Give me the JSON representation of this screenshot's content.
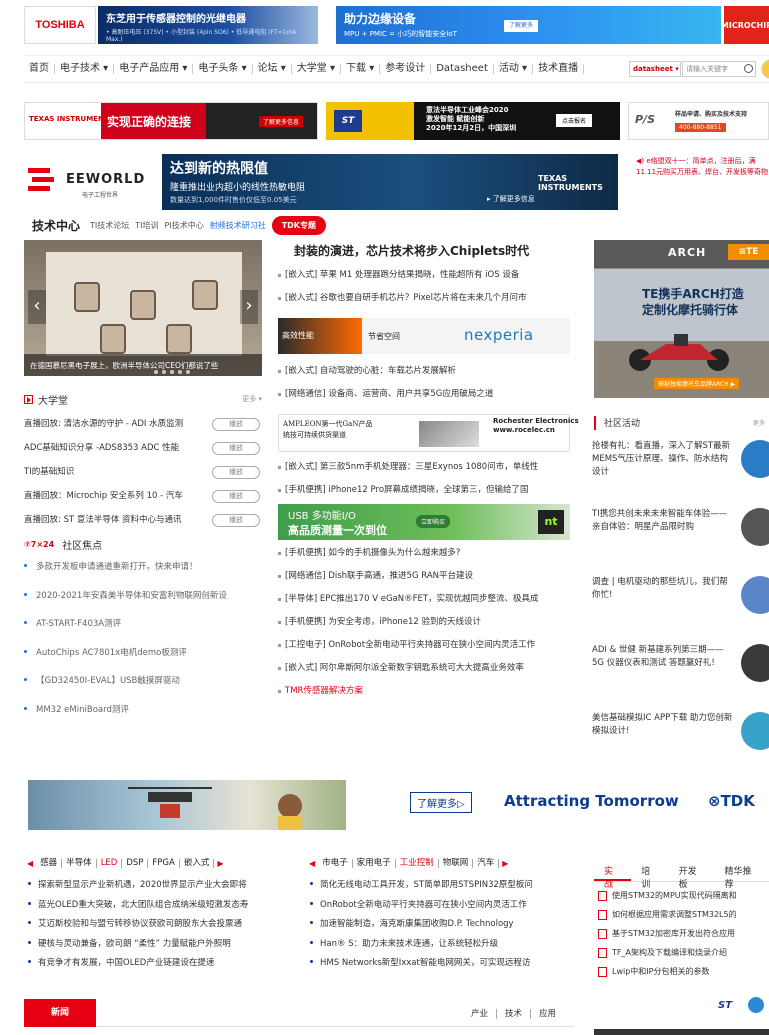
{
  "top_banners": {
    "toshiba_logo": "TOSHIBA",
    "toshiba_title": "东芝用于传感器控制的光继电器",
    "toshiba_sub": "• 高耐压电压 (375V) • 小型封装 (4pin SO6) • 低导通电阻 (FT=1mA Max.)",
    "adi_title": "助力边缘设备",
    "adi_sub": "MPU + PMIC = 小巧的智能安全IoT",
    "adi_btn": "了解更多",
    "microchip": "MICROCHIP"
  },
  "nav": {
    "items": [
      "首页",
      "电子技术 ▾",
      "电子产品应用 ▾",
      "电子头条 ▾",
      "论坛 ▾",
      "大学堂 ▾",
      "下载 ▾",
      "参考设计",
      "Datasheet",
      "活动 ▾",
      "技术直播"
    ],
    "select": "datasheet ▾",
    "search_placeholder": "请输入关键字"
  },
  "ads_row2": {
    "ti_logo": "TEXAS INSTRUMENTS",
    "ti_slogan": "实现正确的连接",
    "ti_more": "了解更多信息",
    "st_text": "意法半导体工业峰会2020\n激发智能 赋能创新\n2020年12月2日，中国深圳",
    "st_btn": "点击报名",
    "ps_logo": "P/S",
    "ps_text": "样品申请、购买及技术支持",
    "ps_phone": "400-880-8851"
  },
  "logo_row": {
    "eeworld": "EEWORLD",
    "eeworld_sub": "电子工程世界",
    "ti_title": "达到新的热限值",
    "ti_sub": "隆重推出业内超小的线性热敏电阻",
    "ti_note": "数量达到1,000件时售价仅低至0.05美元",
    "ti_more": "▸ 了解更多信息",
    "ti_logo": "TEXAS INSTRUMENTS",
    "side_news": "◀) e络盟双十一：简单点，注册后，满11.11元购买万用表、焊台、开发板等奇物"
  },
  "tech_center": {
    "title": "技术中心",
    "items": [
      "TI技术论坛",
      "TI培训",
      "PI技术中心"
    ],
    "highlight": "射频技术研习社",
    "tdk": "TDK专题"
  },
  "slider": {
    "caption": "在德国慕尼黑电子展上，欧洲半导体公司CEO们都说了些"
  },
  "daxue": {
    "title": "大学堂",
    "more": "更多 ▾",
    "play": "播放",
    "items": [
      "直播回放: 清洁水源的守护 - ADI 水质监测",
      "ADC基础知识分享 -ADS8353 ADC 性能",
      "TI的基础知识",
      "直播回放：Microchip 安全系列 10 - 汽车",
      "直播回放: ST 意法半导体 资料中心与通讯"
    ]
  },
  "focus": {
    "badge": "7×24",
    "title": "社区焦点",
    "items": [
      "多款开发板申请通道重新打开。快来申请！",
      "2020-2021年安森美半导体和安富利物联网创新设",
      "AT-START-F403A测评",
      "AutoChips AC7801x电机demo板测评",
      "【GD32450I-EVAL】USB触摸屏驱动",
      "MM32 eMiniBoard测评"
    ]
  },
  "middle": {
    "headline": "封装的演进，芯片技术将步入Chiplets时代",
    "list1": [
      "[嵌入式] 苹果 M1 处理器跑分结果揭晓，性能超所有 iOS 设备",
      "[嵌入式] 谷歌也要自研手机芯片？Pixel芯片将在未来几个月问市"
    ],
    "nexperia_left": "高效性能",
    "nexperia_mid": "节省空间",
    "nexperia_brand": "nexperia",
    "list2": [
      "[嵌入式] 自动驾驶的心脏：车载芯片发展解析",
      "[网络通信] 设备商、运营商、用户共享5G应用破局之道"
    ],
    "amp_text": "AMPLEON第一代GaN产品\n统技可持续供货渠道",
    "amp_brand": "Rochester Electronics\nwww.rocelec.cn",
    "list3": [
      "[嵌入式] 第三款5nm手机处理器：三星Exynos 1080问市，单线性",
      "[手机便携] iPhone12 Pro屏幕成绩揭晓，全球第三，但输给了国"
    ],
    "usb_t1": "USB 多功能I/O",
    "usb_t2": "高品质测量一次到位",
    "usb_btn": "立即购买",
    "usb_logo": "nt",
    "list4": [
      "[手机便携] 如今的手机摄像头为什么越来越多?",
      "[网络通信] Dish联手高通，推进5G RAN平台建设",
      "[半导体] EPC推出170 V eGaN®FET，实现优越同步整流、极具成",
      "[手机便携] 为安全考虑，iPhone12 验到的天线设计",
      "[工控电子] OnRobot全新电动平行夹持器可在狭小空间内灵活工作",
      "[嵌入式] 阿尔卑斯阿尔派全新数字钥匙系统可大大提高业务效率"
    ],
    "red_item": "TMR传感器解决方案"
  },
  "arch_ad": {
    "arch": "ARCH",
    "te": "≡TE",
    "title": "TE携手ARCH打造\n定制化摩托骑行体",
    "caption": "探秘独家摩托车品牌ARCH ▶"
  },
  "community": {
    "title": "社区活动",
    "more": "更多",
    "items": [
      "抢楼有礼：看直播，深入了解ST最新 MEMS气压计原理、操作、防水结构设计",
      "TI携您共创未来未来智能车体验——亲自体验：明星产品限时购",
      "调查 | 电机驱动的那些坑儿，我们帮你忙!",
      "ADI & 世健 新基建系列第三期——5G 仪器仪表和测试 答题赢好礼!",
      "美信基础模拟IC APP下载 助力您创新模拟设计!"
    ]
  },
  "tdk_banner": {
    "more": "了解更多▷",
    "slogan": "Attracting Tomorrow",
    "logo": "⊗TDK"
  },
  "bottom": {
    "cats_left": [
      "感器",
      "半导体",
      "LED",
      "DSP",
      "FPGA",
      "嵌入式"
    ],
    "cats_left_hl": "LED",
    "cats_mid": [
      "市电子",
      "家用电子",
      "工业控制",
      "物联网",
      "汽车"
    ],
    "cats_mid_hl": "工业控制",
    "list_left": [
      "探索新型显示产业新机遇，2020世界显示产业大会即将",
      "蓝光OLED重大突破，北大团队组合成纳米级短激发态寿",
      "艾迈斯校验和与盟亏转移协议获欧司朗股东大会投票通",
      "硬核与灵动兼备，欧司朗 “柔性” 力量赋能户外照明",
      "有竞争才有发展，中国OLED产业链建设在提速"
    ],
    "list_mid": [
      "简化无线电动工具开发，ST简单即用STSPIN32原型板问",
      "OnRobot全新电动平行夹持器可在狭小空间内灵活工作",
      "加速智能制造，海克斯康集团收购D.P. Technology",
      "Han® S：助力未来技术连通，让系统轻松升级",
      "HMS Networks新型Ixxat智能电网网关，可实现远程访"
    ],
    "tabs": [
      "实战",
      "培训",
      "开发板",
      "精华推荐"
    ],
    "tab_items": [
      "使用STM32的MPU实现代码隔离和",
      "如何根据应用需求调整STM32L5的",
      "基于STM32加密库开发出符合应用",
      "TF_A架构及下载编译和烧录介绍",
      "Lwip中和IP分包相关的参数"
    ],
    "st_logo": "ST",
    "news_tab": "新闻",
    "news_links": [
      "产业",
      "技术",
      "应用"
    ]
  },
  "colors": {
    "brand_red": "#e60012",
    "link_blue": "#1a73e8",
    "tdk_blue": "#0a3d8f"
  }
}
